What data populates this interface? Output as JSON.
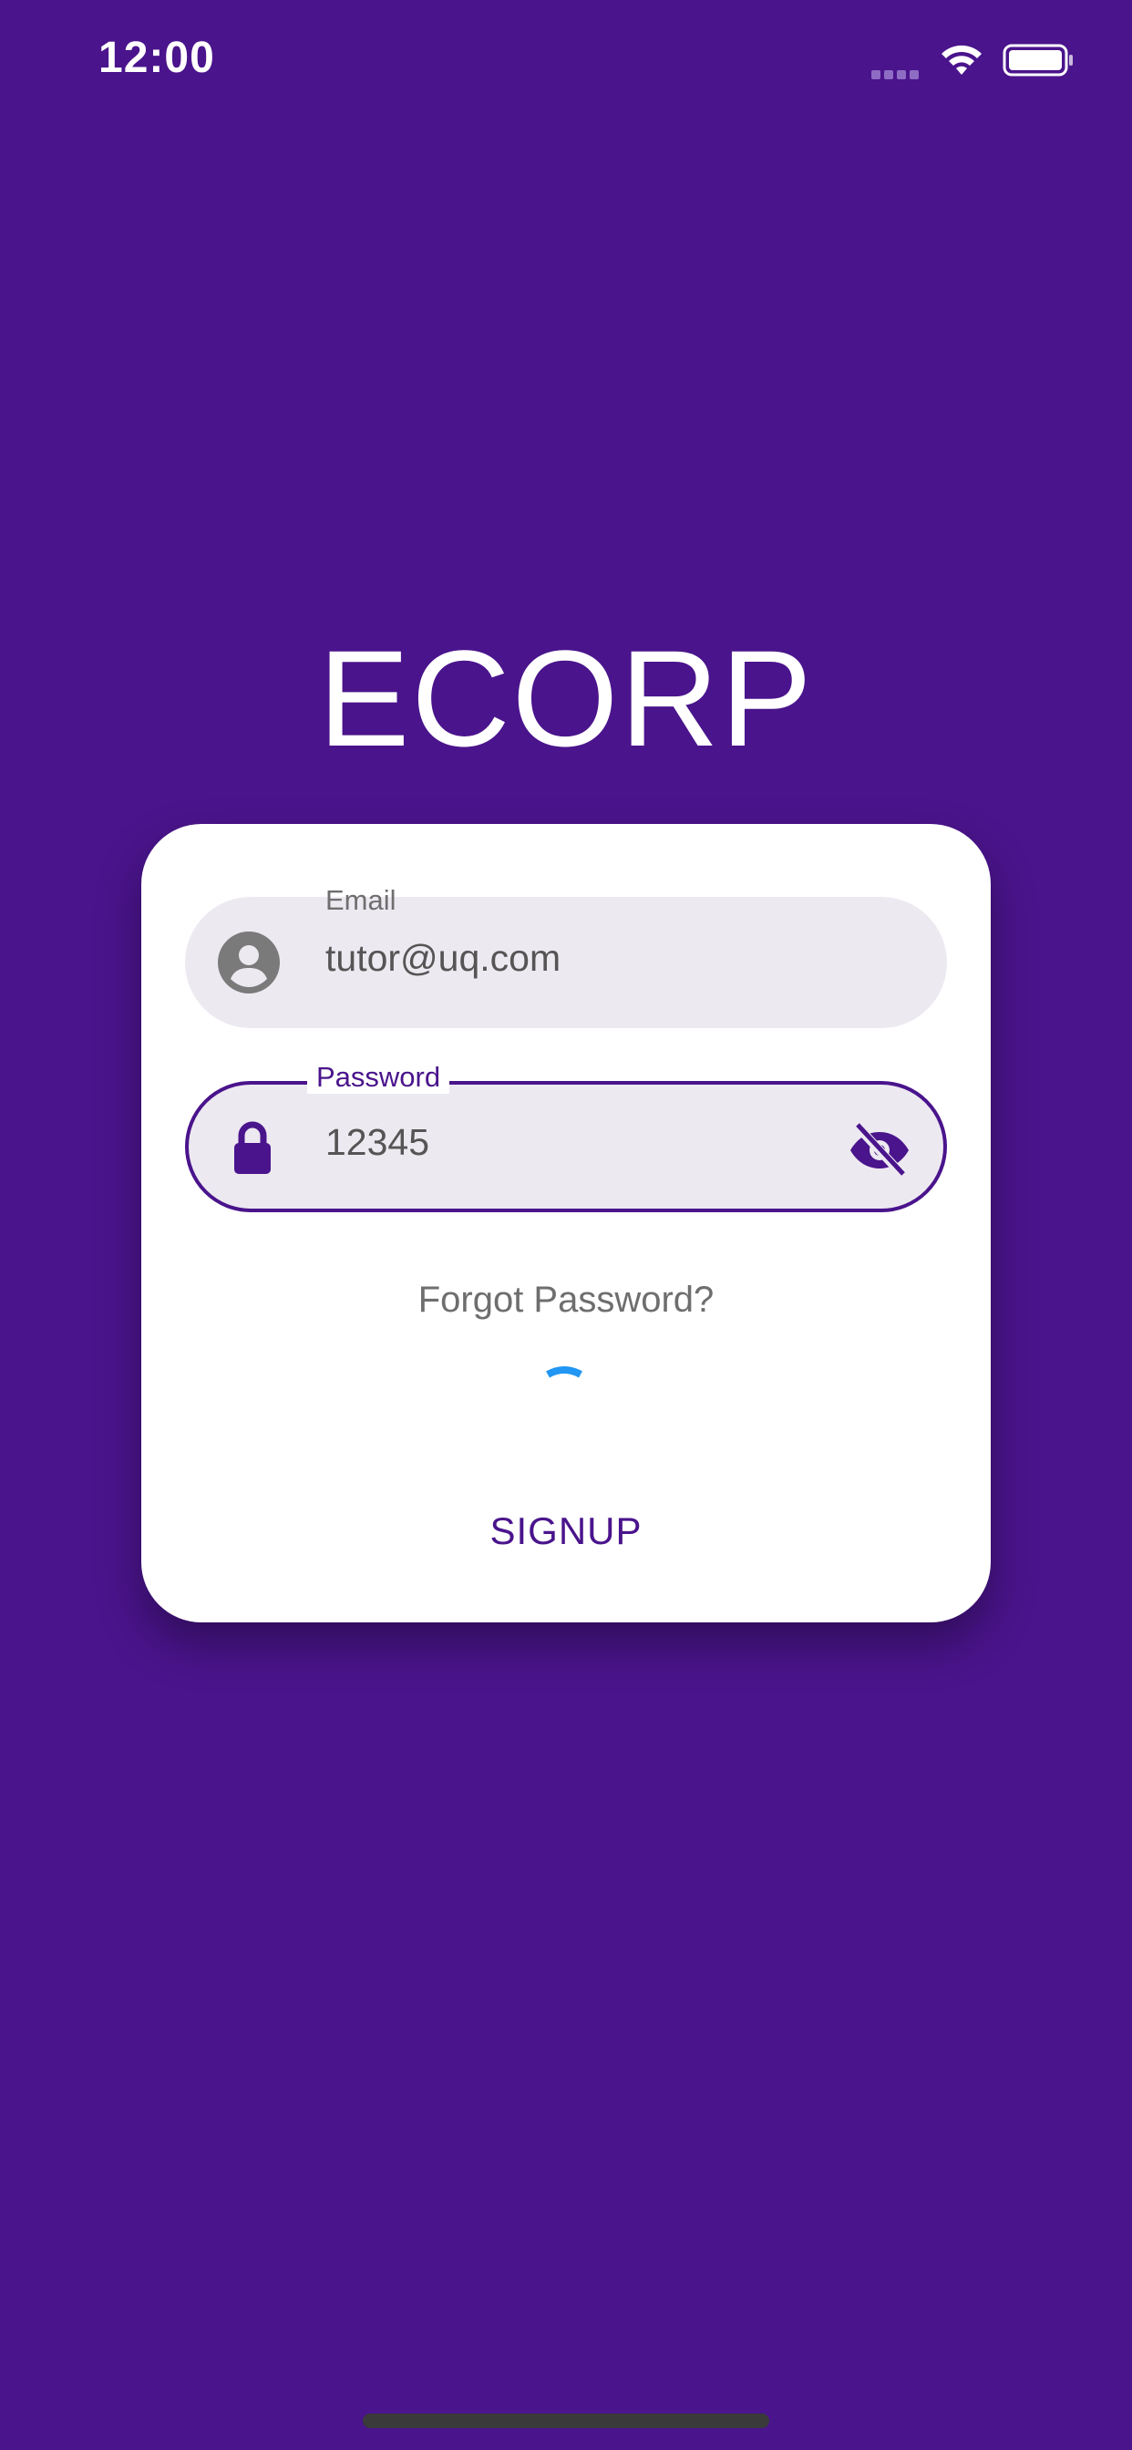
{
  "status_bar": {
    "time": "12:00",
    "signal_icon": "cellular-signal-icon",
    "wifi_icon": "wifi-icon",
    "battery_icon": "battery-icon"
  },
  "app": {
    "title": "ECORP"
  },
  "login_form": {
    "email": {
      "label": "Email",
      "value": "tutor@uq.com",
      "icon": "account-circle-icon"
    },
    "password": {
      "label": "Password",
      "value": "12345",
      "icon": "lock-icon",
      "toggle_icon": "visibility-off-icon"
    },
    "forgot_password": "Forgot Password?",
    "loading_indicator": "progress-spinner-icon",
    "signup_label": "SIGNUP"
  },
  "colors": {
    "background": "#4a148c",
    "accent": "#4a148c",
    "field_fill": "#ede9f1",
    "spinner": "#2196f3",
    "card": "#ffffff"
  }
}
